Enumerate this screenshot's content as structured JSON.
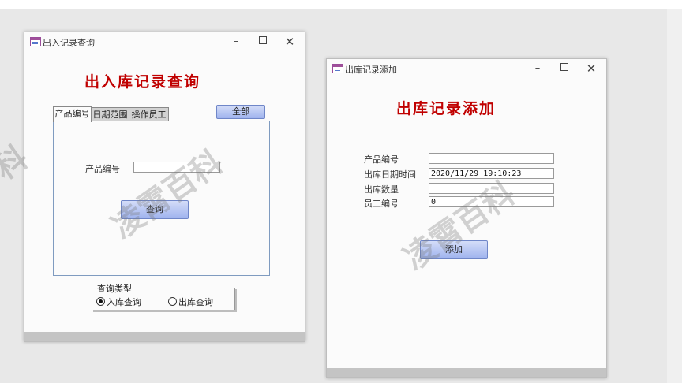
{
  "watermark_text": "凌霄百科",
  "watermark_partial": "科",
  "win1": {
    "title": "出入记录查询",
    "heading": "出入库记录查询",
    "tabs": [
      "产品编号",
      "日期范围",
      "操作员工"
    ],
    "all_button": "全部",
    "product_label": "产品编号",
    "product_value": "",
    "query_button": "查询",
    "query_type": {
      "label": "查询类型",
      "options": [
        {
          "label": "入库查询",
          "selected": true
        },
        {
          "label": "出库查询",
          "selected": false
        }
      ]
    }
  },
  "win2": {
    "title": "出库记录添加",
    "heading": "出库记录添加",
    "fields": [
      {
        "label": "产品编号",
        "value": ""
      },
      {
        "label": "出库日期时间",
        "value": "2020/11/29 19:10:23"
      },
      {
        "label": "出库数量",
        "value": ""
      },
      {
        "label": "员工编号",
        "value": "0"
      }
    ],
    "add_button": "添加"
  },
  "window_controls": {
    "min": "–",
    "close": "✕"
  }
}
